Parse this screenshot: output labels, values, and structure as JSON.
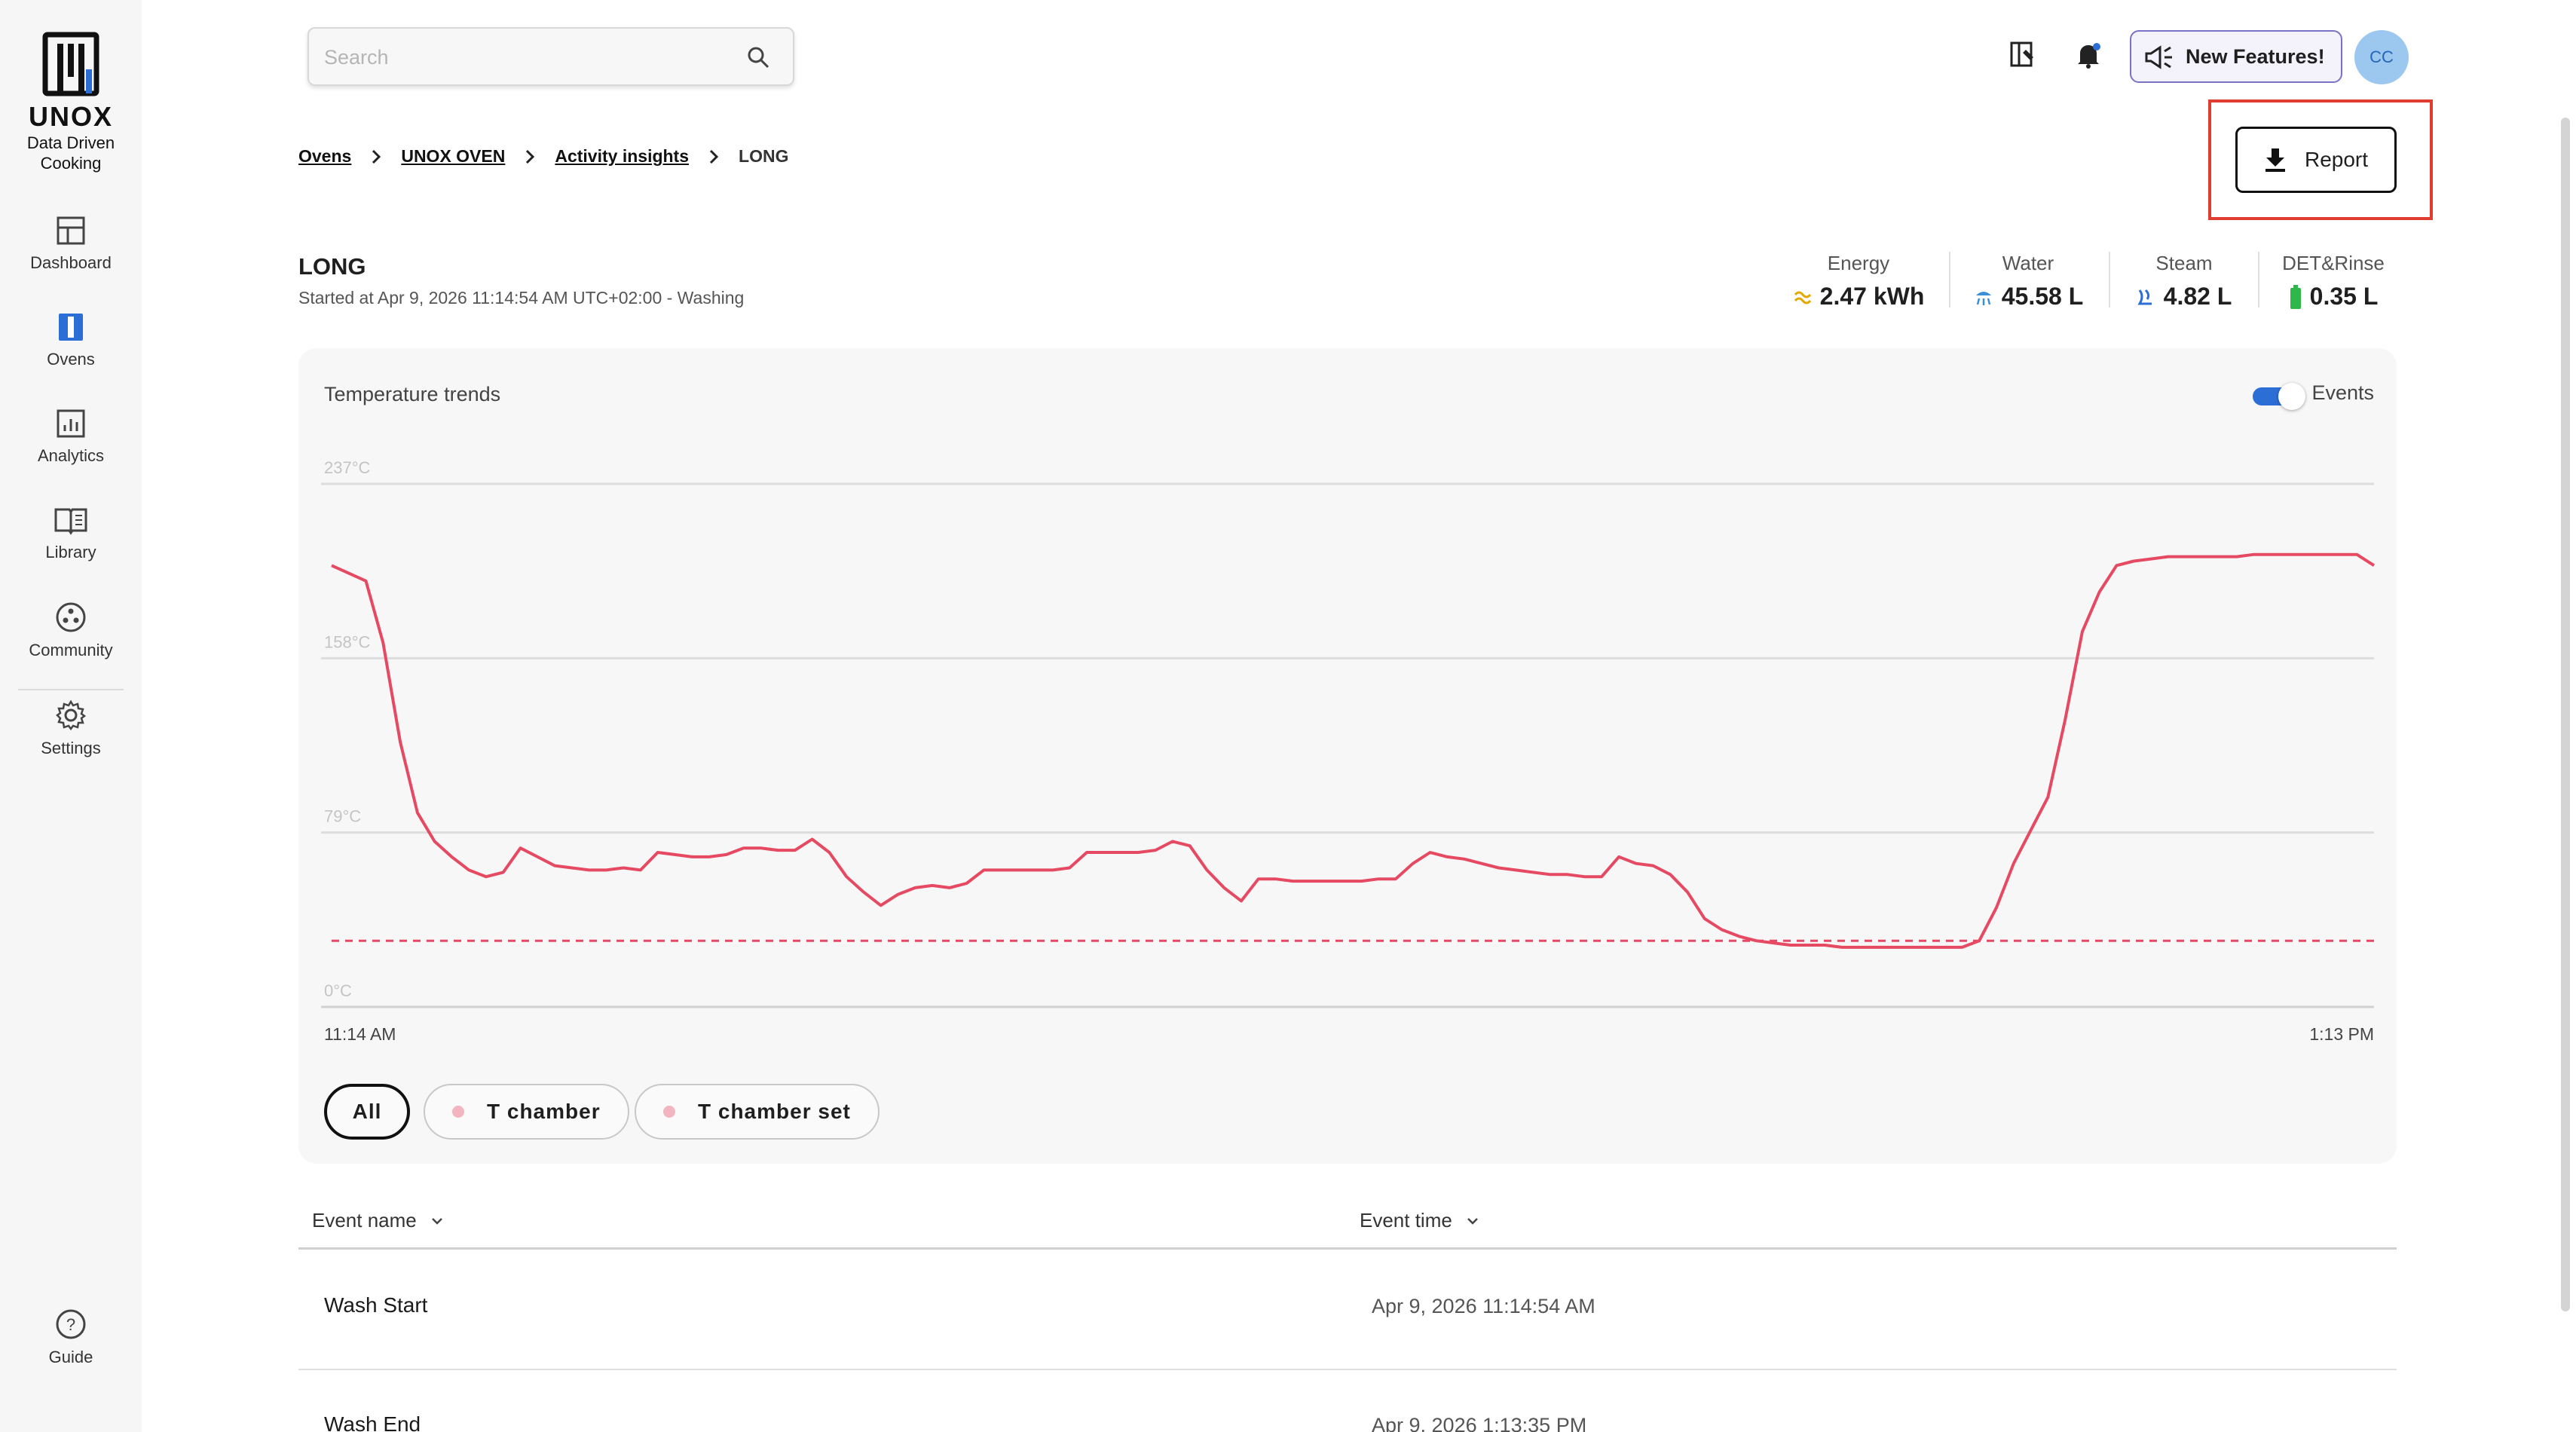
{
  "sidebar": {
    "brand": "UNOX",
    "tagline_1": "Data Driven",
    "tagline_2": "Cooking",
    "items": [
      {
        "label": "Dashboard"
      },
      {
        "label": "Ovens"
      },
      {
        "label": "Analytics"
      },
      {
        "label": "Library"
      },
      {
        "label": "Community"
      },
      {
        "label": "Settings"
      }
    ],
    "guide_label": "Guide"
  },
  "header": {
    "search_placeholder": "Search",
    "new_features_label": "New Features!",
    "avatar_initials": "CC"
  },
  "breadcrumb": {
    "items": [
      "Ovens",
      "UNOX OVEN",
      "Activity insights"
    ],
    "current": "LONG"
  },
  "report_label": "Report",
  "page": {
    "title": "LONG",
    "subtitle": "Started at Apr 9, 2026 11:14:54 AM UTC+02:00 - Washing"
  },
  "stats": [
    {
      "label": "Energy",
      "value": "2.47 kWh"
    },
    {
      "label": "Water",
      "value": "45.58 L"
    },
    {
      "label": "Steam",
      "value": "4.82 L"
    },
    {
      "label": "DET&Rinse",
      "value": "0.35 L"
    }
  ],
  "colors": {
    "series": "#e64a63",
    "accent": "#2b6fd6",
    "highlight": "#e03c2f"
  },
  "chart_card": {
    "title": "Temperature trends",
    "events_label": "Events",
    "events_on": true
  },
  "chart_data": {
    "type": "line",
    "title": "Temperature trends",
    "y_ticks": [
      "237°C",
      "158°C",
      "79°C",
      "0°C"
    ],
    "ylim": [
      0,
      237
    ],
    "x_tick_labels": [
      "11:14 AM",
      "1:13 PM"
    ],
    "x_range_minutes": [
      0,
      119
    ],
    "series": [
      {
        "name": "T chamber",
        "style": "solid",
        "x": [
          0,
          2,
          3,
          4,
          5,
          6,
          7,
          8,
          9,
          10,
          11,
          12,
          13,
          14,
          15,
          16,
          17,
          18,
          19,
          20,
          21,
          22,
          23,
          24,
          25,
          26,
          27,
          28,
          29,
          30,
          31,
          32,
          33,
          34,
          35,
          36,
          37,
          38,
          39,
          40,
          41,
          42,
          43,
          44,
          45,
          46,
          47,
          48,
          49,
          50,
          51,
          52,
          53,
          54,
          55,
          56,
          57,
          58,
          59,
          60,
          61,
          62,
          63,
          64,
          65,
          66,
          67,
          68,
          69,
          70,
          71,
          72,
          73,
          74,
          75,
          76,
          77,
          78,
          79,
          80,
          81,
          82,
          83,
          84,
          85,
          86,
          87,
          88,
          89,
          90,
          91,
          92,
          93,
          94,
          95,
          96,
          97,
          98,
          99,
          100,
          101,
          102,
          103,
          104,
          105,
          106,
          107,
          108,
          109,
          110,
          111,
          112,
          113,
          114,
          115,
          116,
          117,
          118,
          119
        ],
        "y": [
          200,
          193,
          165,
          120,
          88,
          75,
          68,
          62,
          59,
          61,
          72,
          68,
          64,
          63,
          62,
          62,
          63,
          62,
          70,
          69,
          68,
          68,
          69,
          72,
          72,
          71,
          71,
          76,
          70,
          59,
          52,
          46,
          51,
          54,
          55,
          54,
          56,
          62,
          62,
          62,
          62,
          62,
          63,
          70,
          70,
          70,
          70,
          71,
          75,
          73,
          62,
          54,
          48,
          58,
          58,
          57,
          57,
          57,
          57,
          57,
          58,
          58,
          65,
          70,
          68,
          67,
          65,
          63,
          62,
          61,
          60,
          60,
          59,
          59,
          68,
          65,
          64,
          60,
          52,
          40,
          35,
          32,
          30,
          29,
          28,
          28,
          28,
          27,
          27,
          27,
          27,
          27,
          27,
          27,
          27,
          30,
          45,
          65,
          80,
          95,
          130,
          170,
          188,
          200,
          202,
          203,
          204,
          204,
          204,
          204,
          204,
          205,
          205,
          205,
          205,
          205,
          205,
          205,
          200
        ]
      },
      {
        "name": "T chamber set",
        "style": "dashed",
        "x": [
          0,
          119
        ],
        "y": [
          30,
          30
        ]
      }
    ]
  },
  "filters": [
    {
      "label": "All"
    },
    {
      "label": "T chamber"
    },
    {
      "label": "T chamber set"
    }
  ],
  "table": {
    "columns": [
      "Event name",
      "Event time"
    ],
    "rows": [
      {
        "name": "Wash Start",
        "time": "Apr 9, 2026 11:14:54 AM"
      },
      {
        "name": "Wash End",
        "time": "Apr 9, 2026 1:13:35 PM"
      }
    ]
  }
}
